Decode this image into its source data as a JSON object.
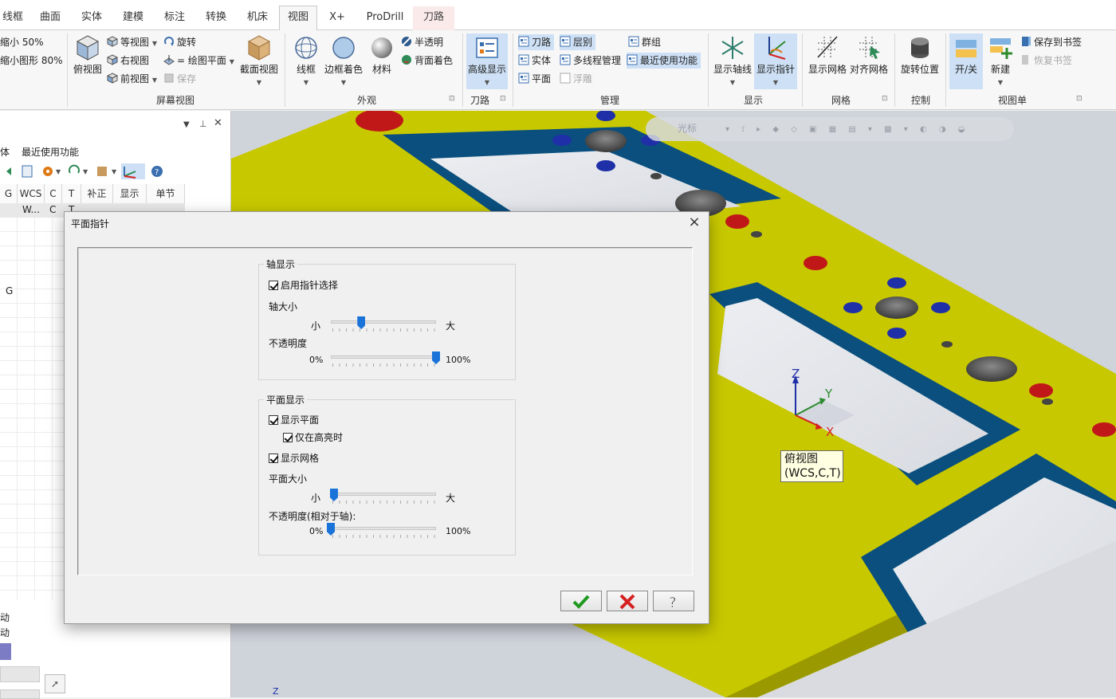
{
  "tabs": [
    "线框",
    "曲面",
    "实体",
    "建模",
    "标注",
    "转换",
    "机床",
    "视图",
    "X+",
    "ProDrill",
    "刀路"
  ],
  "active_tab": "视图",
  "ribbon": {
    "zoom": {
      "shrink50": "缩小 50%",
      "shrink80": "缩小图形 80%"
    },
    "screen_view": {
      "top_view": "俯视图",
      "iso_view": "等视图",
      "right_view": "右视图",
      "front_view": "前视图",
      "rotate": "旋转",
      "draw_plane": "= 绘图平面",
      "save": "保存",
      "section_view": "截面视图",
      "group_label": "屏幕视图"
    },
    "appearance": {
      "wireframe": "线框",
      "edge_shade": "边框着色",
      "material": "材料",
      "translucent": "半透明",
      "back_shade": "背面着色",
      "group_label": "外观"
    },
    "toolpath": {
      "advanced_display": "高级显示",
      "group_label": "刀路"
    },
    "manage": {
      "toolpath": "刀路",
      "layer": "层别",
      "group": "群组",
      "solid": "实体",
      "multithread": "多线程管理",
      "recent": "最近使用功能",
      "plane": "平面",
      "float": "浮雕",
      "group_label": "管理"
    },
    "display": {
      "show_axes": "显示轴线",
      "show_pointer": "显示指针",
      "group_label": "显示"
    },
    "grid": {
      "show_grid": "显示网格",
      "align_grid": "对齐网格",
      "group_label": "网格"
    },
    "control": {
      "rotate_position": "旋转位置",
      "group_label": "控制"
    },
    "viewsheet": {
      "toggle": "开/关",
      "new": "新建",
      "save_bookmark": "保存到书签",
      "restore_bookmark": "恢复书签",
      "group_label": "视图单"
    }
  },
  "left_panel": {
    "tabs": [
      "体",
      "最近使用功能"
    ],
    "columns": [
      "G",
      "WCS",
      "C",
      "T",
      "补正",
      "显示",
      "单节"
    ],
    "row1": [
      "W...",
      "C",
      "T"
    ],
    "row2_g": "G",
    "bottom_labels": [
      "动",
      "动"
    ]
  },
  "viewport": {
    "floating_toolbar_label": "光标",
    "axes": {
      "x": "X",
      "y": "Y",
      "z": "Z"
    },
    "tooltip_line1": "俯视图",
    "tooltip_line2": "(WCS,C,T)",
    "corner_z": "Z"
  },
  "dialog": {
    "title": "平面指针",
    "axis_display": {
      "legend": "轴显示",
      "enable_pointer_select": "启用指针选择",
      "enable_pointer_select_checked": true,
      "axis_size_label": "轴大小",
      "axis_size_min": "小",
      "axis_size_max": "大",
      "axis_size_value": 0.29,
      "opacity_label": "不透明度",
      "opacity_min": "0%",
      "opacity_max": "100%",
      "opacity_value": 1.0
    },
    "plane_display": {
      "legend": "平面显示",
      "show_plane": "显示平面",
      "show_plane_checked": true,
      "only_highlight": "仅在高亮时",
      "only_highlight_checked": true,
      "show_grid": "显示网格",
      "show_grid_checked": true,
      "plane_size_label": "平面大小",
      "plane_size_min": "小",
      "plane_size_max": "大",
      "plane_size_value": 0.03,
      "rel_opacity_label": "不透明度(相对于轴):",
      "rel_opacity_min": "0%",
      "rel_opacity_max": "100%",
      "rel_opacity_value": 0.0
    },
    "colors": {
      "ok": "#1f9a1f",
      "cancel": "#d62020",
      "slider": "#1a73d9"
    }
  }
}
